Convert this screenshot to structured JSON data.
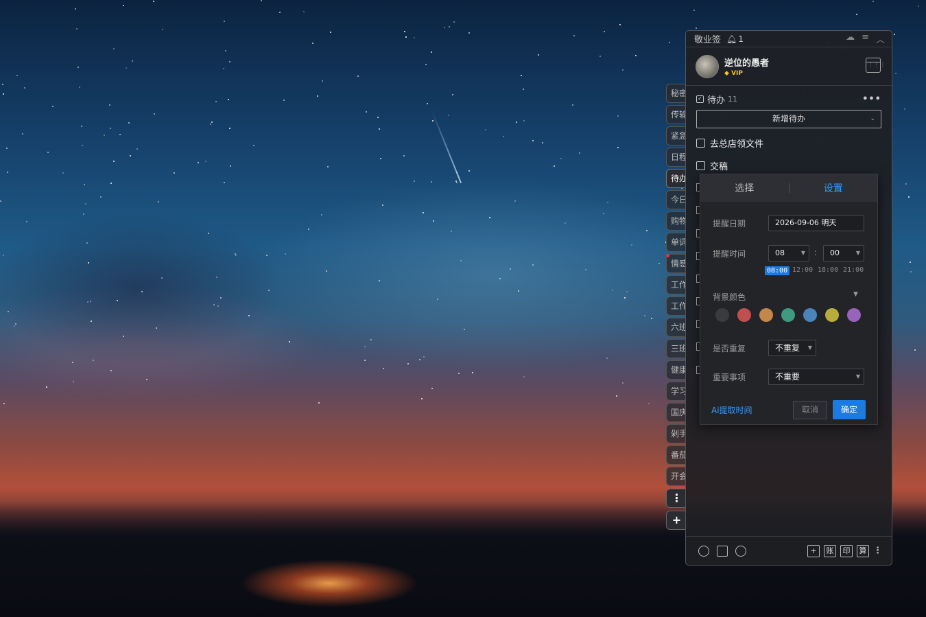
{
  "app": {
    "title": "敬业签",
    "notification_count": "1"
  },
  "user": {
    "name": "逆位的愚者",
    "badge": "VIP"
  },
  "side_tabs": [
    "秘密",
    "传输",
    "紧急",
    "日程",
    "待办",
    "今日",
    "购物",
    "单词",
    "情感",
    "工作",
    "工作",
    "六班",
    "三班",
    "健康",
    "学习",
    "国庆",
    "剁手",
    "番茄",
    "开会"
  ],
  "active_tab_index": 4,
  "todo": {
    "title": "待办",
    "count": "11",
    "add_label": "新增待办",
    "items": [
      "去总店领文件",
      "交稿"
    ]
  },
  "popup": {
    "tab_select": "选择",
    "tab_settings": "设置",
    "date_label": "提醒日期",
    "date_value": "2026-09-06 明天",
    "time_label": "提醒时间",
    "hour_value": "08",
    "minute_value": "00",
    "colon": ":",
    "quick_times": [
      "08:00",
      "12:00",
      "18:00",
      "21:00"
    ],
    "bg_color_label": "背景颜色",
    "colors": [
      "#3a3b3f",
      "#c0504f",
      "#c4874a",
      "#3e9b82",
      "#4a84b8",
      "#b8ad3a",
      "#9863ba"
    ],
    "repeat_label": "是否重复",
    "repeat_value": "不重复",
    "important_label": "重要事项",
    "important_value": "不重要",
    "ai_link": "Ai提取时间",
    "cancel": "取消",
    "confirm": "确定"
  },
  "footer": {
    "btn_account": "账",
    "btn_print": "印",
    "btn_calc": "算"
  }
}
